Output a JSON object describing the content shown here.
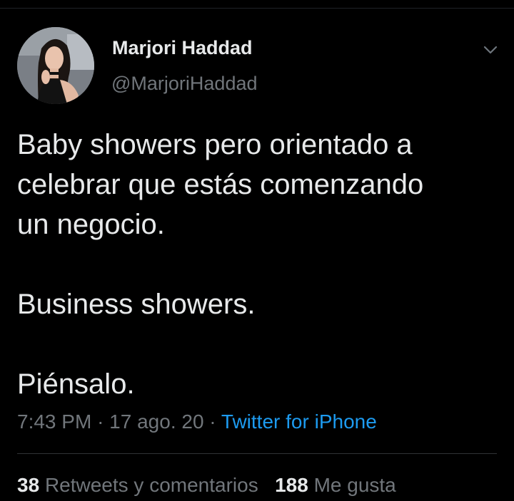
{
  "user": {
    "name": "Marjori Haddad",
    "handle": "@MarjoriHaddad"
  },
  "tweet": {
    "lines": [
      "Baby showers pero orientado a",
      "celebrar que estás comenzando",
      "un negocio.",
      "Business showers.",
      "Piénsalo."
    ],
    "time": "7:43 PM",
    "date": "17 ago. 20",
    "separator": "·",
    "source": "Twitter for iPhone"
  },
  "stats": {
    "retweets_count": "38",
    "retweets_label": "Retweets y comentarios",
    "likes_count": "188",
    "likes_label": "Me gusta"
  },
  "icons": {
    "menu": "chevron-down-icon"
  },
  "colors": {
    "background": "#000000",
    "text": "#e7e9ea",
    "secondary": "#71767b",
    "link": "#1d9bf0"
  }
}
